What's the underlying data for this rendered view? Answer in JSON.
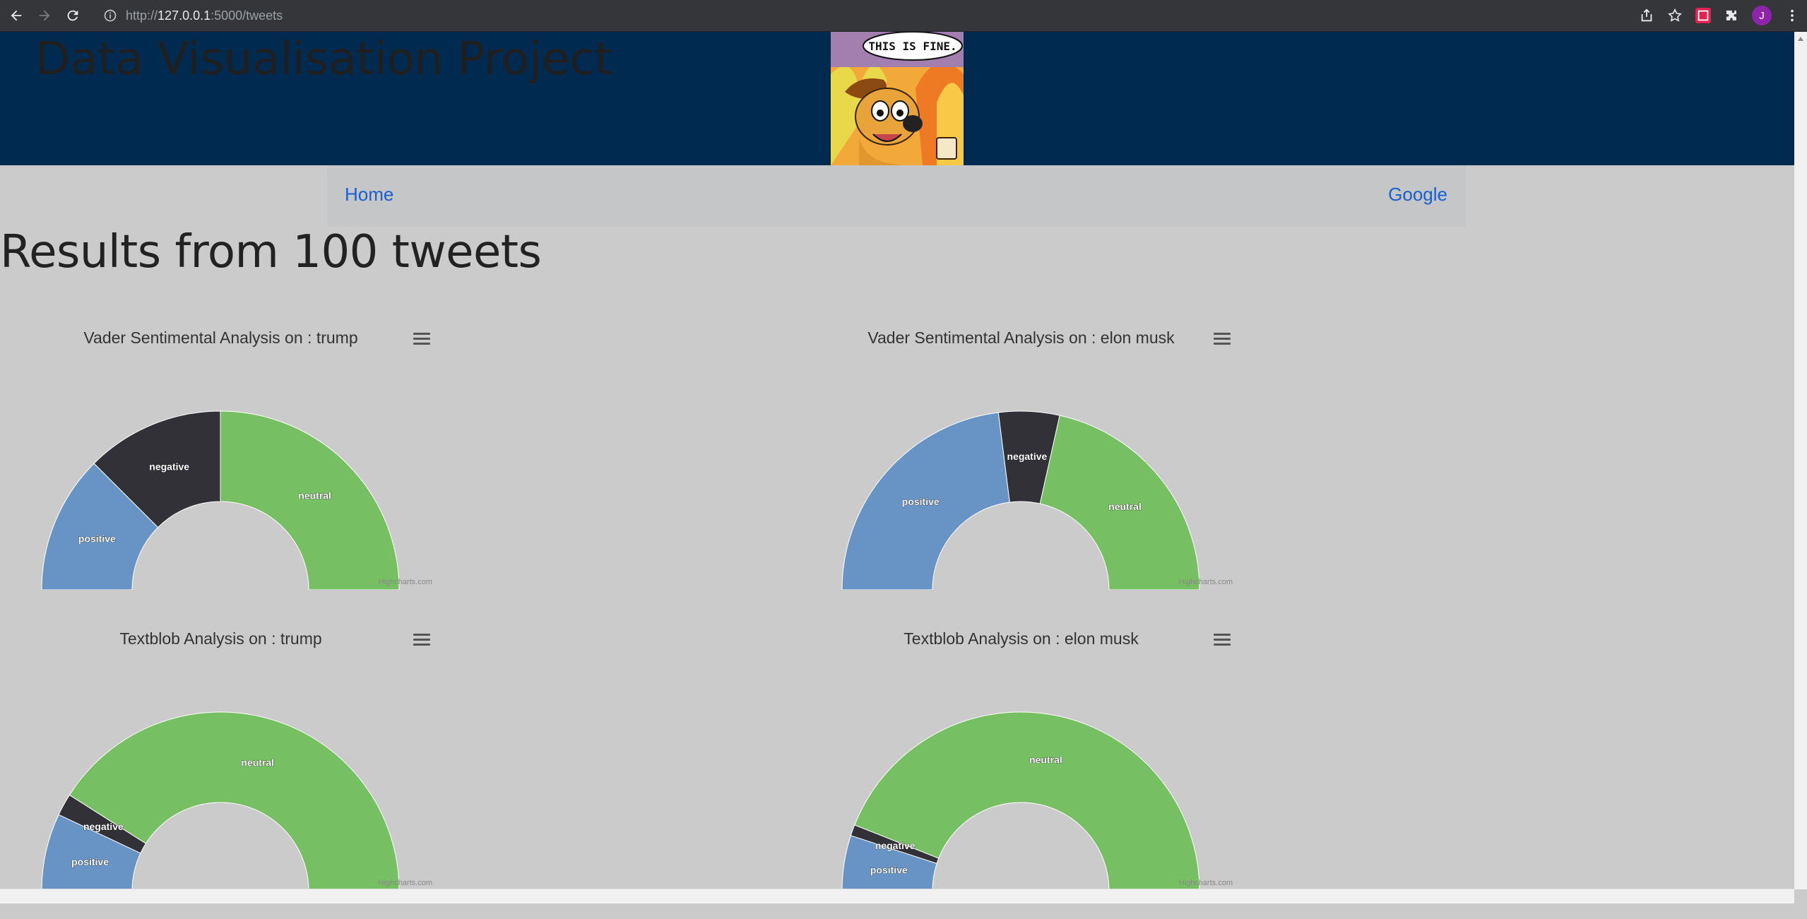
{
  "browser": {
    "url_scheme": "http://",
    "url_host": "127.0.0.1",
    "url_rest": ":5000/tweets",
    "avatar_letter": "J"
  },
  "header": {
    "site_title": "Data Visualisation Project",
    "meme_caption": "THIS IS FINE."
  },
  "nav": {
    "home": "Home",
    "google": "Google"
  },
  "page": {
    "heading": "Results from 100 tweets"
  },
  "colors": {
    "positive": "#6794c5",
    "negative": "#313137",
    "neutral": "#76bf63"
  },
  "credit": "Highcharts.com",
  "chart_data": [
    {
      "type": "pie",
      "variant": "semi-donut",
      "title": "Vader Sentimental Analysis on : trump",
      "categories": [
        "positive",
        "negative",
        "neutral"
      ],
      "values": [
        25,
        25,
        50
      ]
    },
    {
      "type": "pie",
      "variant": "semi-donut",
      "title": "Vader Sentimental Analysis on : elon musk",
      "categories": [
        "positive",
        "negative",
        "neutral"
      ],
      "values": [
        46,
        11,
        43
      ]
    },
    {
      "type": "pie",
      "variant": "semi-donut",
      "title": "Textblob Analysis on : trump",
      "categories": [
        "positive",
        "negative",
        "neutral"
      ],
      "values": [
        14,
        4,
        82
      ]
    },
    {
      "type": "pie",
      "variant": "semi-donut",
      "title": "Textblob Analysis on : elon musk",
      "categories": [
        "positive",
        "negative",
        "neutral"
      ],
      "values": [
        10,
        2,
        88
      ]
    }
  ]
}
